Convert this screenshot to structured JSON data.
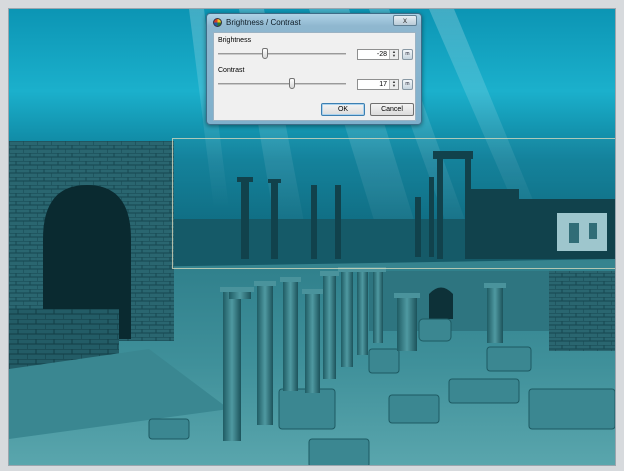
{
  "dialog": {
    "title": "Brightness / Contrast",
    "close_glyph": "x",
    "brightness": {
      "label": "Brightness",
      "value": "-28",
      "level": -28,
      "min": -100,
      "max": 100
    },
    "contrast": {
      "label": "Contrast",
      "value": "17",
      "level": 17,
      "min": -100,
      "max": 100
    },
    "unit_button_label": "m",
    "ok_label": "OK",
    "cancel_label": "Cancel"
  },
  "icons": {
    "title": "palette-icon",
    "close": "close-icon",
    "spin": "spin-arrows-icon"
  },
  "colors": {
    "water_top": "#17aac8",
    "water_deep": "#05475a",
    "stone": "#2f6f78",
    "sand": "#5aa4ad",
    "dialog_frame": "#8fb7cf"
  }
}
